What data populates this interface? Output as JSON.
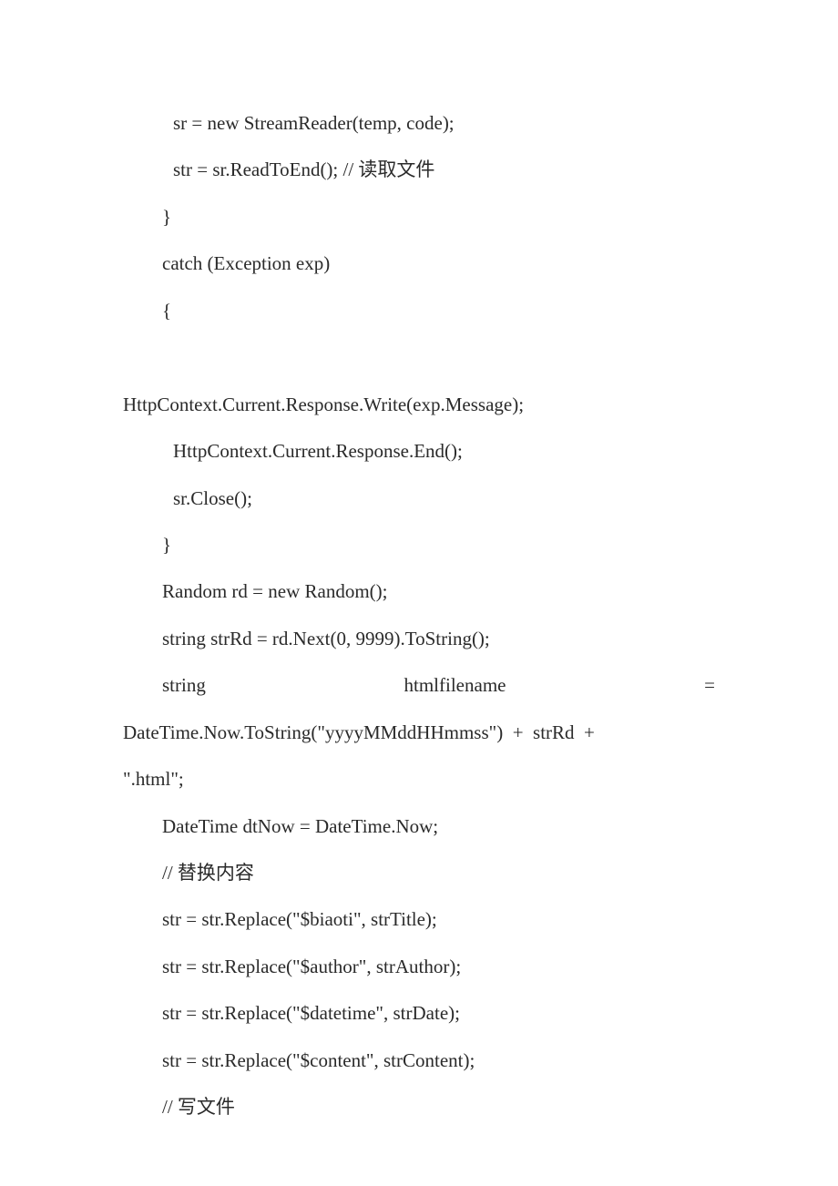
{
  "code": {
    "lines": [
      {
        "indent": "ind2",
        "text": "sr = new StreamReader(temp, code);"
      },
      {
        "indent": "ind2",
        "text": "str = sr.ReadToEnd(); // 读取文件"
      },
      {
        "indent": "ind1",
        "text": "}"
      },
      {
        "indent": "ind1",
        "text": "catch (Exception exp)"
      },
      {
        "indent": "ind1",
        "text": "{"
      },
      {
        "indent": "",
        "text": " "
      },
      {
        "indent": "",
        "text": "HttpContext.Current.Response.Write(exp.Message);"
      },
      {
        "indent": "ind2",
        "text": "HttpContext.Current.Response.End();"
      },
      {
        "indent": "ind2",
        "text": "sr.Close();"
      },
      {
        "indent": "ind1",
        "text": "}"
      },
      {
        "indent": "ind1",
        "text": "Random rd = new Random();"
      },
      {
        "indent": "ind1",
        "text": "string strRd = rd.Next(0, 9999).ToString();"
      }
    ],
    "justifyLine": {
      "a": "string",
      "b": "htmlfilename",
      "c": "="
    },
    "afterJustify": [
      {
        "indent": "",
        "text": "DateTime.Now.ToString(\"yyyyMMddHHmmss\")  +  strRd  +"
      },
      {
        "indent": "",
        "text": "\".html\";"
      },
      {
        "indent": "ind1",
        "text": "DateTime dtNow = DateTime.Now;"
      },
      {
        "indent": "ind1",
        "text": "// 替换内容"
      },
      {
        "indent": "ind1",
        "text": "str = str.Replace(\"$biaoti\", strTitle);"
      },
      {
        "indent": "ind1",
        "text": "str = str.Replace(\"$author\", strAuthor);"
      },
      {
        "indent": "ind1",
        "text": "str = str.Replace(\"$datetime\", strDate);"
      },
      {
        "indent": "ind1",
        "text": "str = str.Replace(\"$content\", strContent);"
      },
      {
        "indent": "ind1",
        "text": "// 写文件"
      }
    ]
  }
}
